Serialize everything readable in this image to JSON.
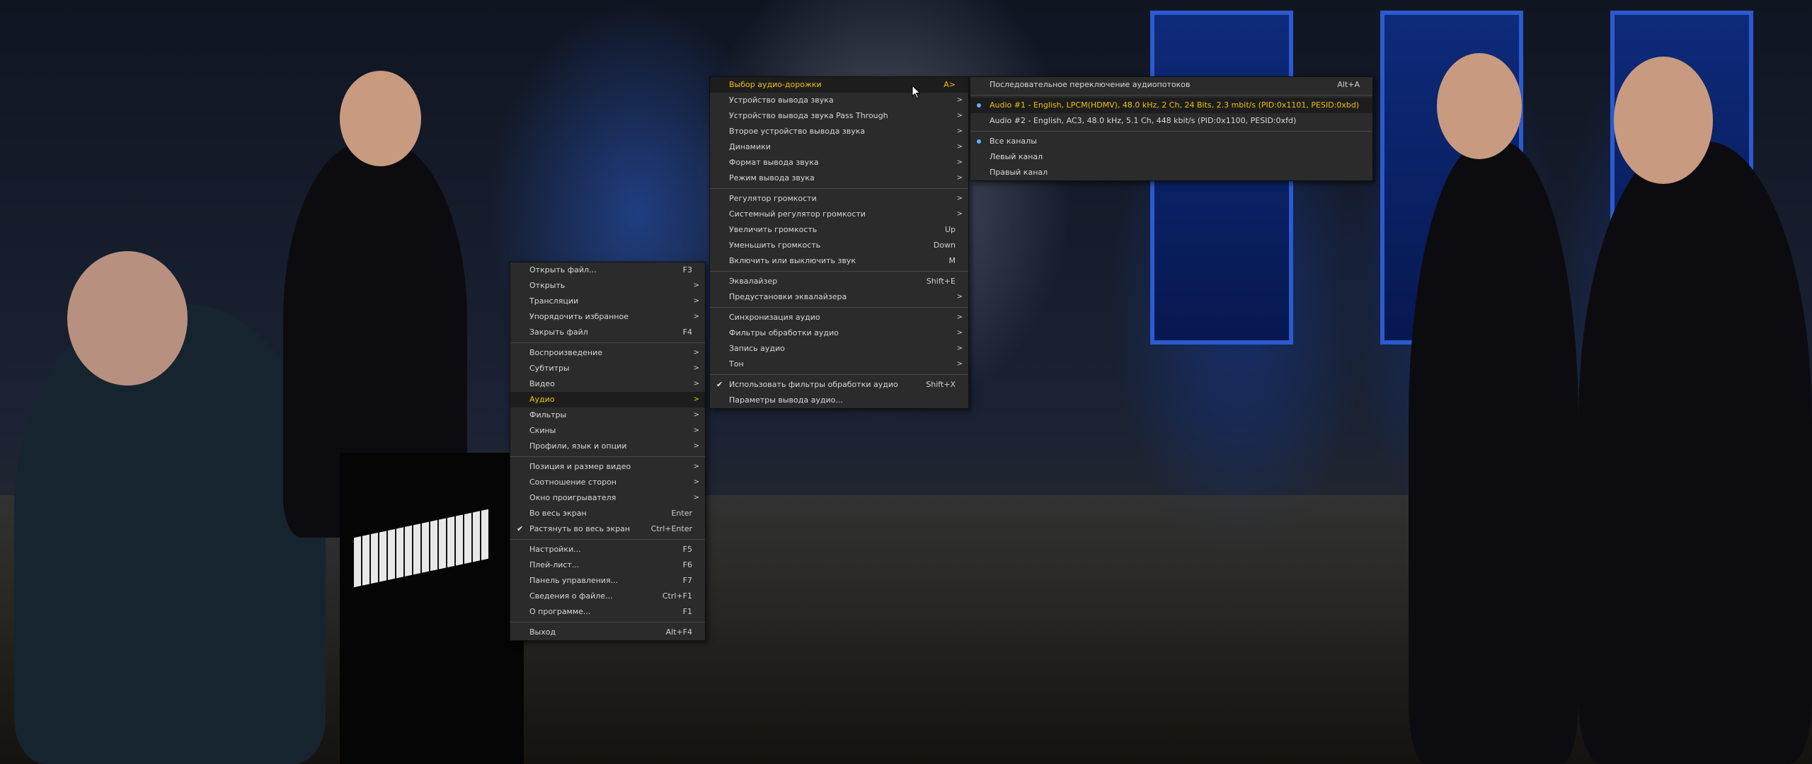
{
  "main_menu": [
    {
      "label": "Открыть файл...",
      "shortcut": "F3"
    },
    {
      "label": "Открыть",
      "arrow": ">"
    },
    {
      "label": "Трансляции",
      "arrow": ">"
    },
    {
      "label": "Упорядочить избранное",
      "arrow": ">"
    },
    {
      "label": "Закрыть файл",
      "shortcut": "F4"
    },
    {
      "sep": true
    },
    {
      "label": "Воспроизведение",
      "arrow": ">"
    },
    {
      "label": "Субтитры",
      "arrow": ">"
    },
    {
      "label": "Видео",
      "arrow": ">"
    },
    {
      "label": "Аудио",
      "arrow": ">",
      "active": true
    },
    {
      "label": "Фильтры",
      "arrow": ">"
    },
    {
      "label": "Скины",
      "arrow": ">"
    },
    {
      "label": "Профили, язык и опции",
      "arrow": ">"
    },
    {
      "sep": true
    },
    {
      "label": "Позиция и размер видео",
      "arrow": ">"
    },
    {
      "label": "Соотношение сторон",
      "arrow": ">"
    },
    {
      "label": "Окно проигрывателя",
      "arrow": ">"
    },
    {
      "label": "Во весь экран",
      "shortcut": "Enter"
    },
    {
      "label": "Растянуть во весь экран",
      "shortcut": "Ctrl+Enter",
      "checked": true
    },
    {
      "sep": true
    },
    {
      "label": "Настройки...",
      "shortcut": "F5"
    },
    {
      "label": "Плей-лист...",
      "shortcut": "F6"
    },
    {
      "label": "Панель управления...",
      "shortcut": "F7"
    },
    {
      "label": "Сведения о файле...",
      "shortcut": "Ctrl+F1"
    },
    {
      "label": "О программе...",
      "shortcut": "F1"
    },
    {
      "sep": true
    },
    {
      "label": "Выход",
      "shortcut": "Alt+F4"
    }
  ],
  "audio_menu": [
    {
      "label": "Выбор аудио-дорожки",
      "shortcut": "A>",
      "active": true
    },
    {
      "label": "Устройство вывода звука",
      "arrow": ">"
    },
    {
      "label": "Устройство вывода звука Pass Through",
      "arrow": ">"
    },
    {
      "label": "Второе устройство вывода звука",
      "arrow": ">"
    },
    {
      "label": "Динамики",
      "arrow": ">"
    },
    {
      "label": "Формат вывода звука",
      "arrow": ">"
    },
    {
      "label": "Режим вывода звука",
      "arrow": ">"
    },
    {
      "sep": true
    },
    {
      "label": "Регулятор громкости",
      "arrow": ">"
    },
    {
      "label": "Системный регулятор громкости",
      "arrow": ">"
    },
    {
      "label": "Увеличить громкость",
      "shortcut": "Up"
    },
    {
      "label": "Уменьшить громкость",
      "shortcut": "Down"
    },
    {
      "label": "Включить или выключить звук",
      "shortcut": "M"
    },
    {
      "sep": true
    },
    {
      "label": "Эквалайзер",
      "shortcut": "Shift+E"
    },
    {
      "label": "Предустановки эквалайзера",
      "arrow": ">"
    },
    {
      "sep": true
    },
    {
      "label": "Синхронизация аудио",
      "arrow": ">"
    },
    {
      "label": "Фильтры обработки аудио",
      "arrow": ">"
    },
    {
      "label": "Запись аудио",
      "arrow": ">"
    },
    {
      "label": "Тон",
      "arrow": ">"
    },
    {
      "sep": true
    },
    {
      "label": "Использовать фильтры обработки аудио",
      "shortcut": "Shift+X",
      "checked": true
    },
    {
      "label": "Параметры вывода аудио..."
    }
  ],
  "tracks_menu": [
    {
      "label": "Последовательное переключение аудиопотоков",
      "shortcut": "Alt+A"
    },
    {
      "sep": true
    },
    {
      "label": "Audio #1 - English, LPCM(HDMV), 48.0 kHz, 2 Ch, 24 Bits, 2.3 mbit/s (PID:0x1101, PESID:0xbd)",
      "radio": true,
      "active": true
    },
    {
      "label": "Audio #2 - English, AC3, 48.0 kHz, 5.1 Ch, 448 kbit/s (PID:0x1100, PESID:0xfd)"
    },
    {
      "sep": true
    },
    {
      "label": "Все каналы",
      "radio": true
    },
    {
      "label": "Левый канал"
    },
    {
      "label": "Правый канал"
    }
  ],
  "icons": {
    "check": "checkmark-icon",
    "radio": "radio-dot-icon",
    "arrow": "chevron-right-icon",
    "cursor": "mouse-pointer-icon"
  },
  "colors": {
    "menu_bg": "#2b2b2b",
    "highlight_text": "#f2c200",
    "radio": "#6aa8ff"
  }
}
